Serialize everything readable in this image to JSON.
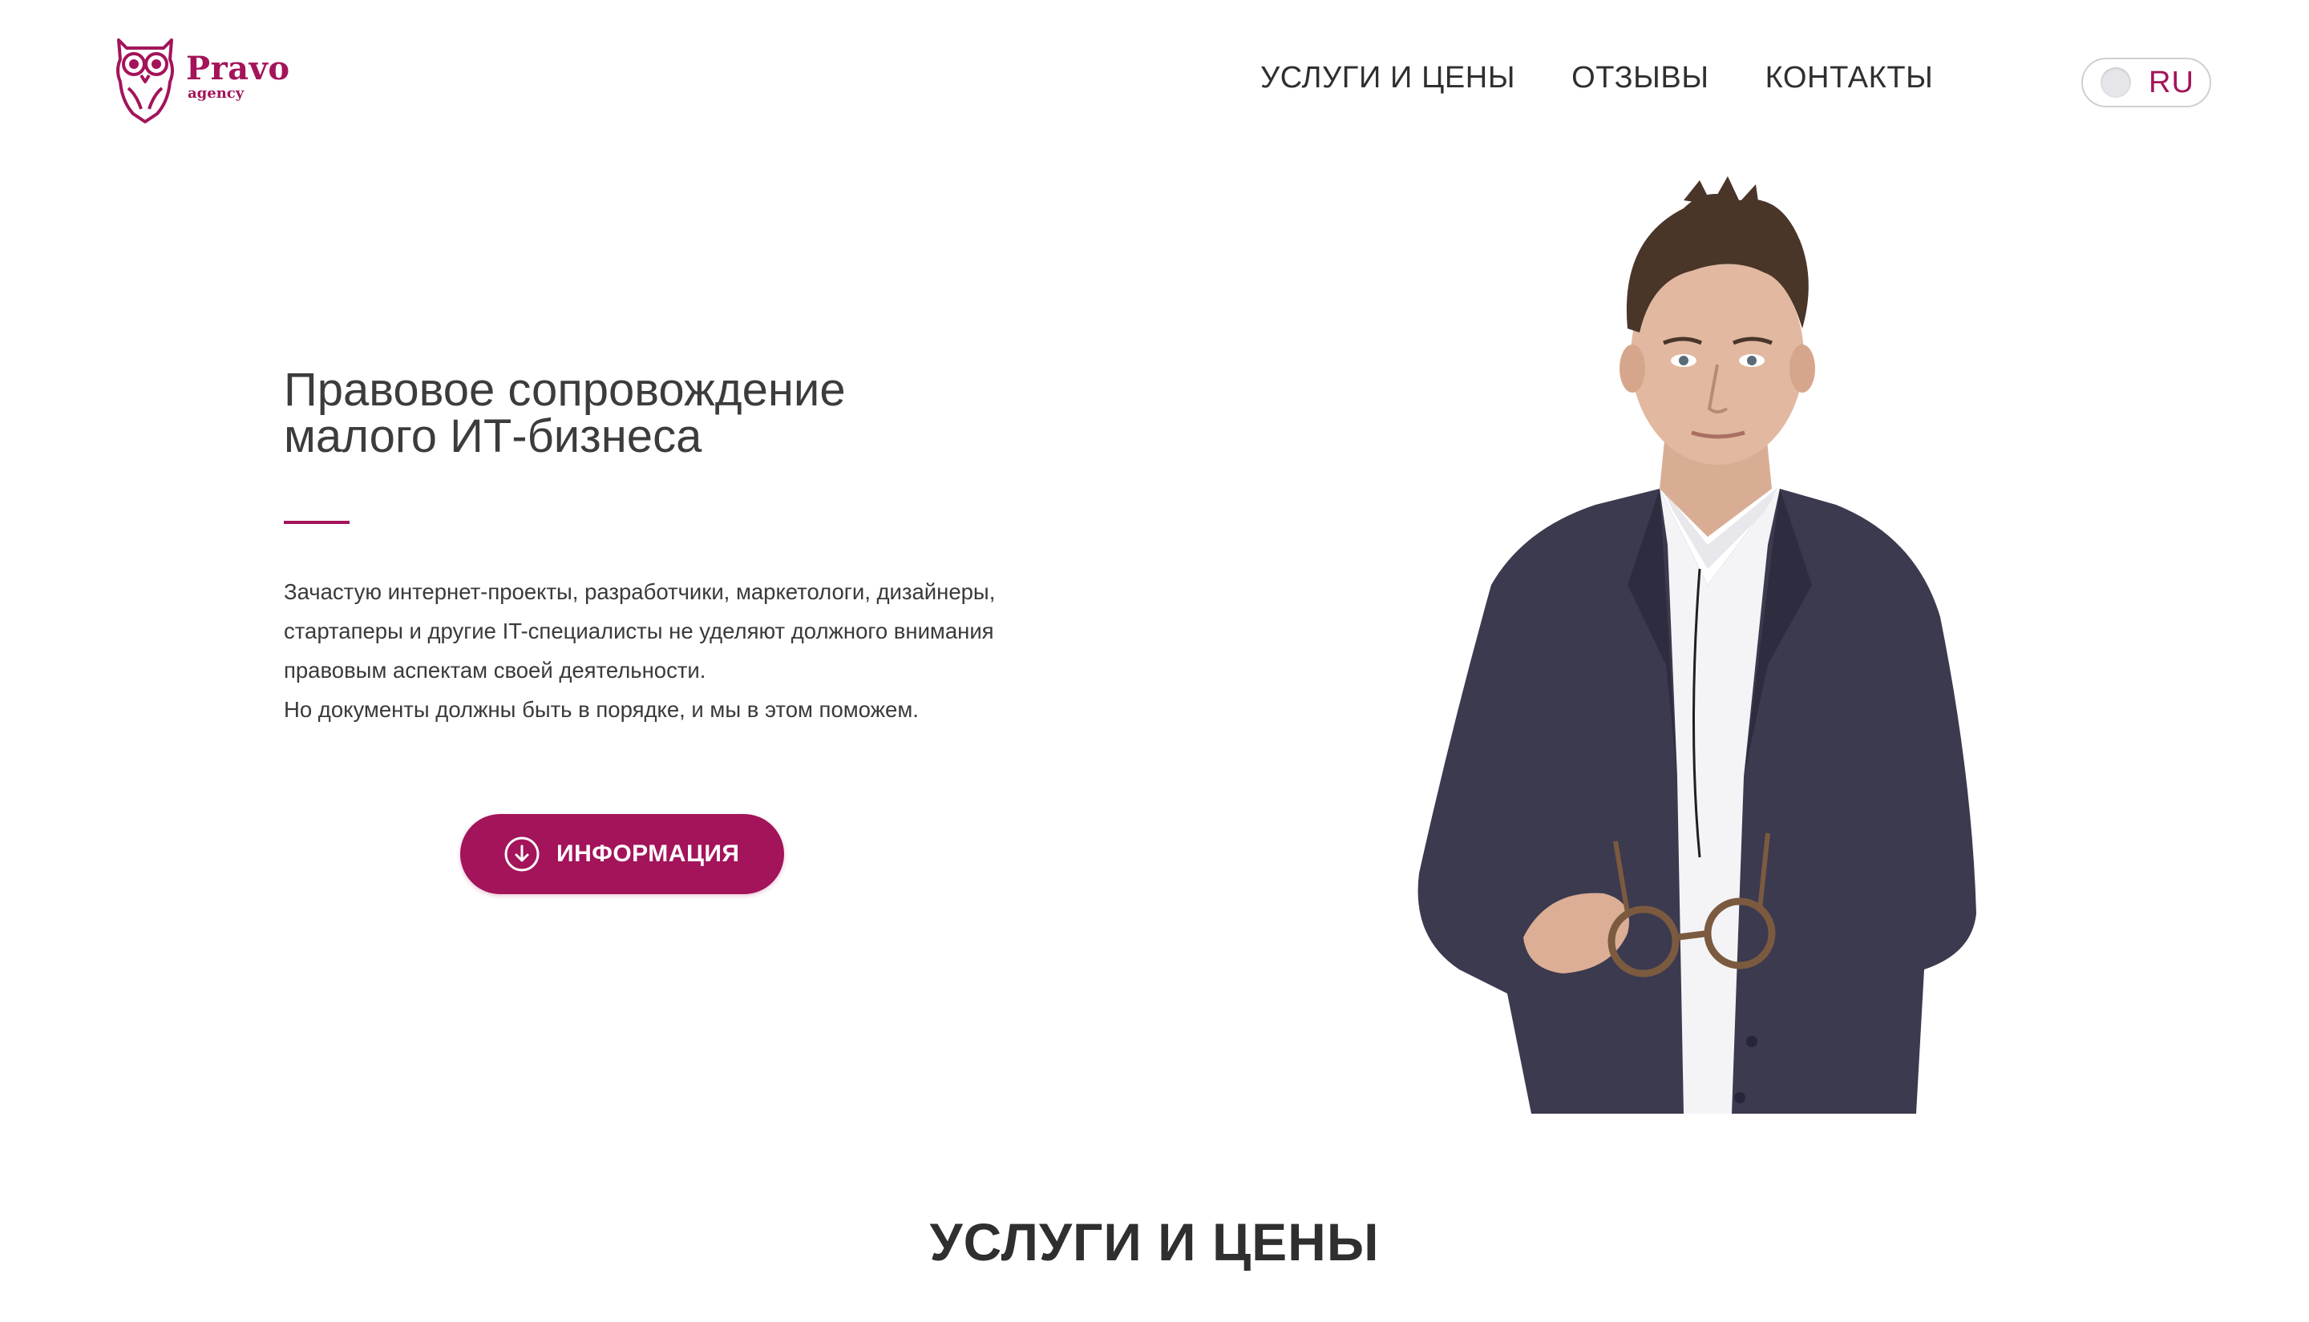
{
  "header": {
    "logo_name": "Pravo",
    "logo_sub": "agency",
    "nav": [
      "УСЛУГИ И ЦЕНЫ",
      "ОТЗЫВЫ",
      "КОНТАКТЫ"
    ],
    "language": "RU"
  },
  "hero": {
    "title_lines": [
      "Правовое сопровождение",
      "малого ИТ-бизнеса"
    ],
    "text_lines": [
      "Зачастую интернет-проекты, разработчики, маркетологи, дизайнеры,",
      "стартаперы и другие IT-специалисты не уделяют должного внимания",
      "правовым аспектам своей деятельности.",
      "Но документы должны быть в порядке, и мы в этом поможем."
    ],
    "button_label": "ИНФОРМАЦИЯ"
  },
  "sections": {
    "services_title": "УСЛУГИ И ЦЕНЫ"
  },
  "colors": {
    "accent": "#a3145a",
    "text": "#3a3a3a",
    "suit": "#3b3a4f",
    "shirt": "#f4f4f6"
  },
  "icons": {
    "logo": "owl-icon",
    "button": "arrow-down-circle-icon"
  }
}
